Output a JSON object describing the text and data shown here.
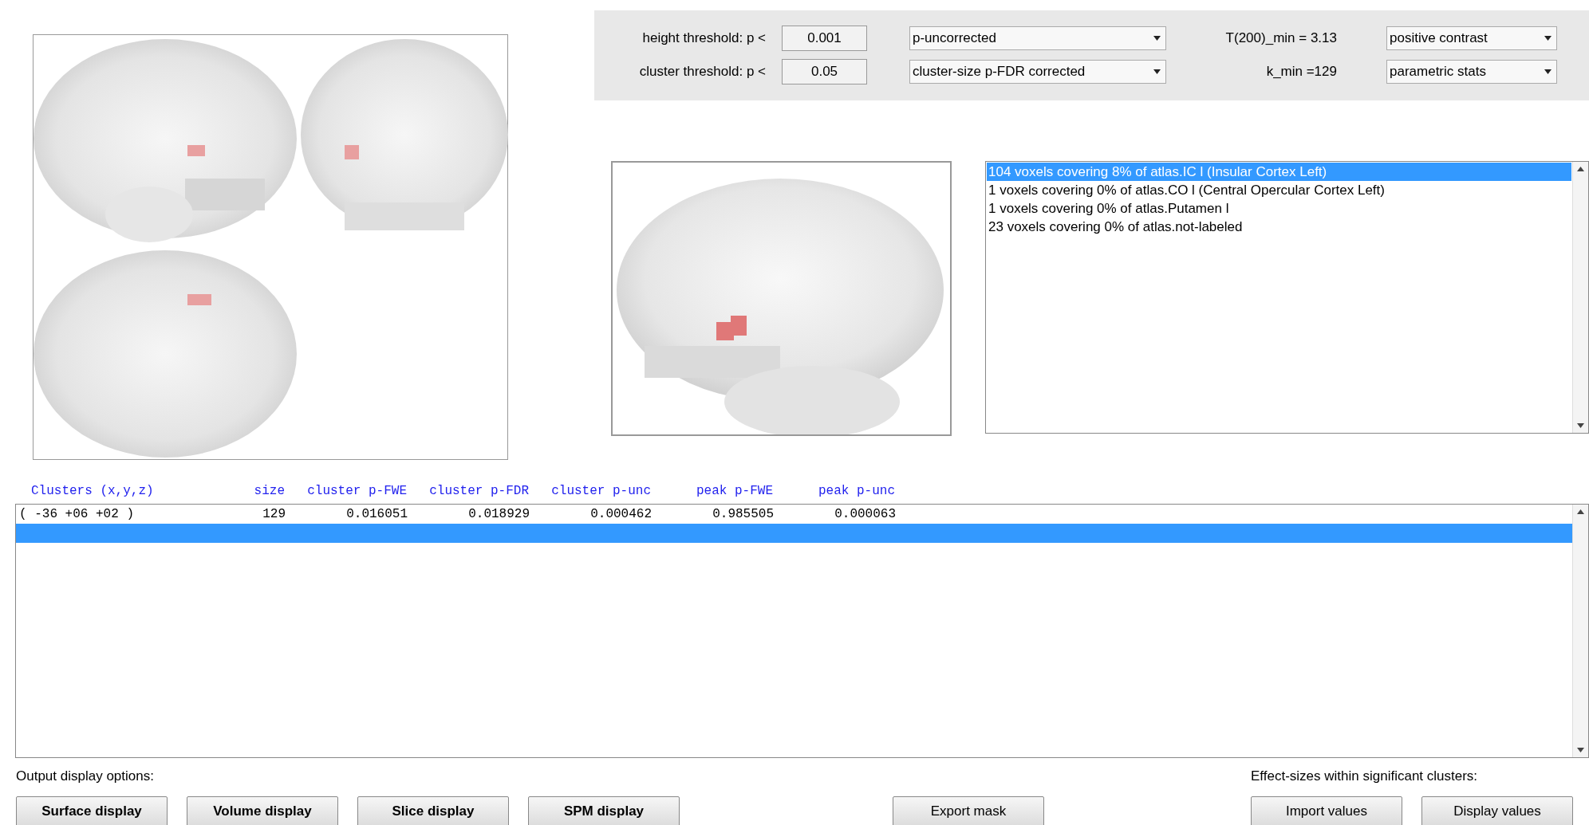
{
  "thresholds": [
    {
      "label": "height threshold: p <",
      "value": "0.001",
      "correction": "p-uncorrected",
      "stat": "T(200)_min = 3.13",
      "option": "positive contrast"
    },
    {
      "label": "cluster threshold: p <",
      "value": "0.05",
      "correction": "cluster-size p-FDR corrected",
      "stat": "k_min =129",
      "option": "parametric stats"
    }
  ],
  "atlas_list": [
    {
      "text": "104 voxels covering 8% of atlas.IC l (Insular Cortex Left)",
      "selected": true
    },
    {
      "text": "1 voxels covering 0% of atlas.CO l (Central Opercular Cortex Left)",
      "selected": false
    },
    {
      "text": "1 voxels covering 0% of atlas.Putamen l",
      "selected": false
    },
    {
      "text": "23 voxels covering 0% of atlas.not-labeled",
      "selected": false
    }
  ],
  "table": {
    "columns": [
      "Clusters (x,y,z)",
      "size",
      "cluster p-FWE",
      "cluster p-FDR",
      "cluster p-unc",
      "peak p-FWE",
      "peak p-unc"
    ],
    "rows": [
      {
        "cells": [
          "( -36 +06 +02 )",
          "129",
          "0.016051",
          "0.018929",
          "0.000462",
          "0.985505",
          "0.000063"
        ],
        "selected": false
      },
      {
        "selected": true
      }
    ]
  },
  "output_display": {
    "label": "Output display options:",
    "buttons": [
      {
        "label": "Surface display",
        "bold": true
      },
      {
        "label": "Volume display",
        "bold": true
      },
      {
        "label": "Slice display",
        "bold": true
      },
      {
        "label": "SPM display",
        "bold": true
      }
    ]
  },
  "export_button": {
    "label": "Export mask",
    "bold": false
  },
  "effect_sizes": {
    "label": "Effect-sizes within significant clusters:",
    "buttons": [
      {
        "label": "Import values",
        "bold": false
      },
      {
        "label": "Display values",
        "bold": false
      }
    ]
  }
}
